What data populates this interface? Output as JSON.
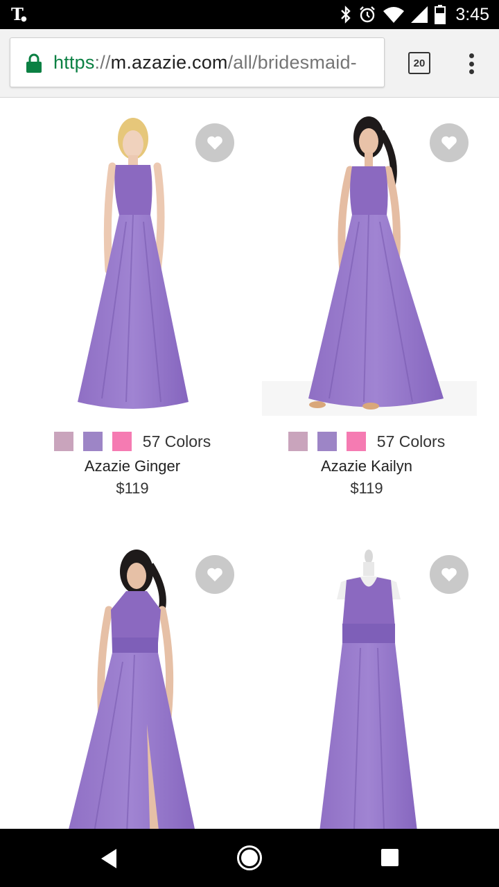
{
  "status_bar": {
    "carrier": "T",
    "time": "3:45"
  },
  "browser": {
    "url_scheme": "https",
    "url_separator": "://",
    "url_host": "m.azazie.com",
    "url_path": "/all/bridesmaid-",
    "tab_count": "20"
  },
  "colors": {
    "dress": "#9475c9",
    "dress_dark": "#7e5fb8",
    "fav_bg": "#c9c9c9",
    "url_green": "#0b8043"
  },
  "products": [
    {
      "name": "Azazie Ginger",
      "price": "$119",
      "colors_label": "57 Colors",
      "swatches": [
        "#c9a4bc",
        "#9d85c6",
        "#f57bb2"
      ]
    },
    {
      "name": "Azazie Kailyn",
      "price": "$119",
      "colors_label": "57 Colors",
      "swatches": [
        "#c9a4bc",
        "#9d85c6",
        "#f57bb2"
      ]
    },
    {
      "name": "",
      "price": "",
      "colors_label": "",
      "swatches": []
    },
    {
      "name": "",
      "price": "",
      "colors_label": "",
      "swatches": []
    }
  ]
}
